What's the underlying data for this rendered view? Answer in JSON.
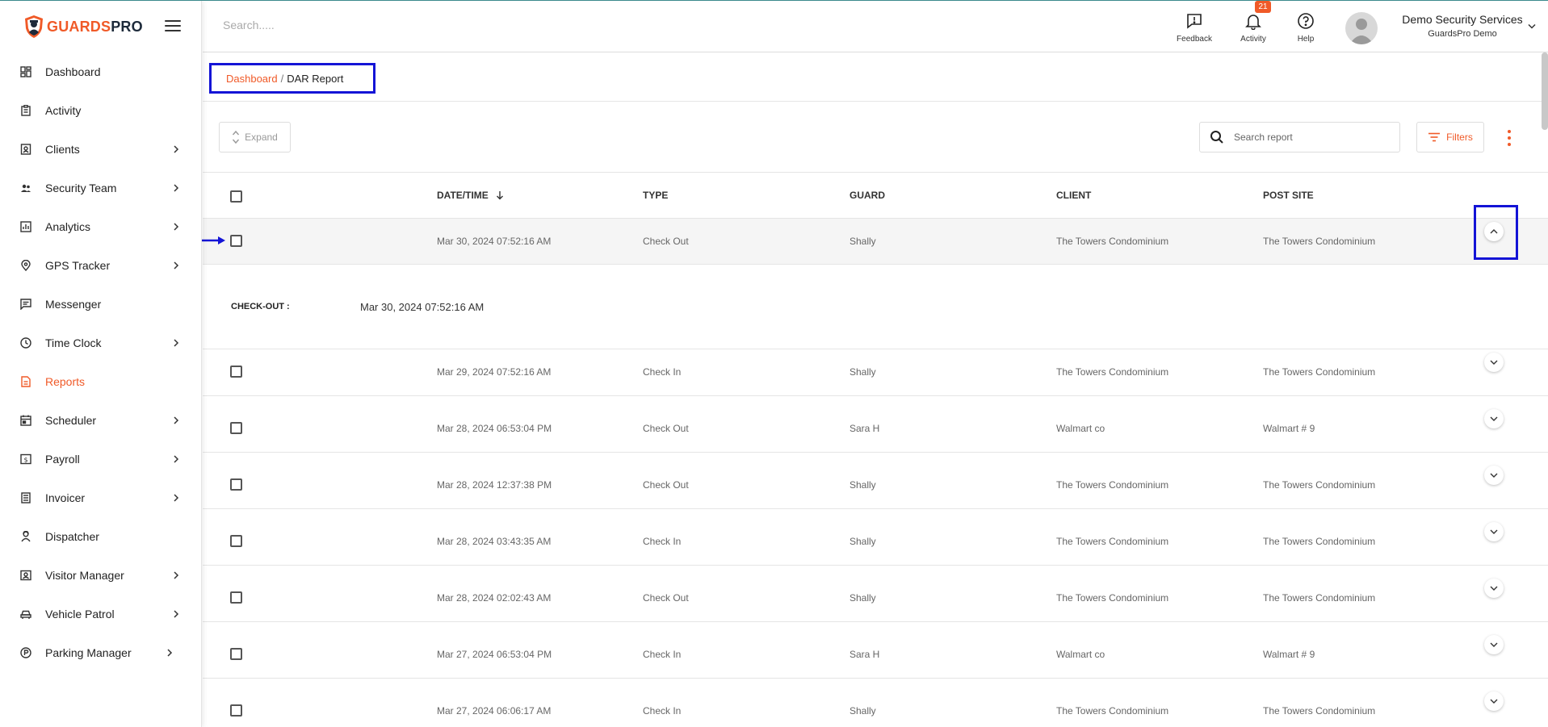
{
  "brand": {
    "part1": "GUARDS",
    "part2": "PRO",
    "colors": {
      "accent": "#f05a28",
      "dark": "#1d2a3a",
      "annotation": "#1414d6"
    }
  },
  "header": {
    "search_placeholder": "Search.....",
    "feedback_label": "Feedback",
    "activity_label": "Activity",
    "activity_badge": "21",
    "help_label": "Help",
    "company_name": "Demo Security Services",
    "company_sub": "GuardsPro Demo"
  },
  "sidebar": {
    "items": [
      {
        "label": "Dashboard",
        "icon": "dashboard-icon"
      },
      {
        "label": "Activity",
        "icon": "clipboard-icon"
      },
      {
        "label": "Clients",
        "icon": "clients-icon"
      },
      {
        "label": "Security Team",
        "icon": "team-icon"
      },
      {
        "label": "Analytics",
        "icon": "chart-icon"
      },
      {
        "label": "GPS Tracker",
        "icon": "location-pin-icon"
      },
      {
        "label": "Messenger",
        "icon": "message-icon"
      },
      {
        "label": "Time Clock",
        "icon": "clock-icon"
      },
      {
        "label": "Reports",
        "icon": "report-icon"
      },
      {
        "label": "Scheduler",
        "icon": "calendar-icon"
      },
      {
        "label": "Payroll",
        "icon": "payroll-icon"
      },
      {
        "label": "Invoicer",
        "icon": "invoice-icon"
      },
      {
        "label": "Dispatcher",
        "icon": "dispatcher-icon"
      },
      {
        "label": "Visitor Manager",
        "icon": "visitor-icon"
      },
      {
        "label": "Vehicle Patrol",
        "icon": "car-icon"
      },
      {
        "label": "Parking Manager",
        "icon": "parking-icon"
      }
    ]
  },
  "breadcrumb": {
    "link": "Dashboard",
    "sep": "/",
    "current": "DAR Report"
  },
  "toolbar": {
    "expand_label": "Expand",
    "search_placeholder": "Search report",
    "filters_label": "Filters"
  },
  "table": {
    "columns": [
      "DATE/TIME",
      "TYPE",
      "GUARD",
      "CLIENT",
      "POST SITE"
    ],
    "rows": [
      {
        "datetime": "Mar 30, 2024 07:52:16 AM",
        "type": "Check Out",
        "guard": "Shally",
        "client": "The Towers Condominium",
        "site": "The Towers Condominium"
      },
      {
        "datetime": "Mar 29, 2024 07:52:16 AM",
        "type": "Check In",
        "guard": "Shally",
        "client": "The Towers Condominium",
        "site": "The Towers Condominium"
      },
      {
        "datetime": "Mar 28, 2024 06:53:04 PM",
        "type": "Check Out",
        "guard": "Sara H",
        "client": "Walmart co",
        "site": "Walmart # 9"
      },
      {
        "datetime": "Mar 28, 2024 12:37:38 PM",
        "type": "Check Out",
        "guard": "Shally",
        "client": "The Towers Condominium",
        "site": "The Towers Condominium"
      },
      {
        "datetime": "Mar 28, 2024 03:43:35 AM",
        "type": "Check In",
        "guard": "Shally",
        "client": "The Towers Condominium",
        "site": "The Towers Condominium"
      },
      {
        "datetime": "Mar 28, 2024 02:02:43 AM",
        "type": "Check Out",
        "guard": "Shally",
        "client": "The Towers Condominium",
        "site": "The Towers Condominium"
      },
      {
        "datetime": "Mar 27, 2024 06:53:04 PM",
        "type": "Check In",
        "guard": "Sara H",
        "client": "Walmart co",
        "site": "Walmart # 9"
      },
      {
        "datetime": "Mar 27, 2024 06:06:17 AM",
        "type": "Check In",
        "guard": "Shally",
        "client": "The Towers Condominium",
        "site": "The Towers Condominium"
      }
    ],
    "expanded_detail": {
      "label": "CHECK-OUT :",
      "value": "Mar 30, 2024 07:52:16 AM"
    }
  }
}
